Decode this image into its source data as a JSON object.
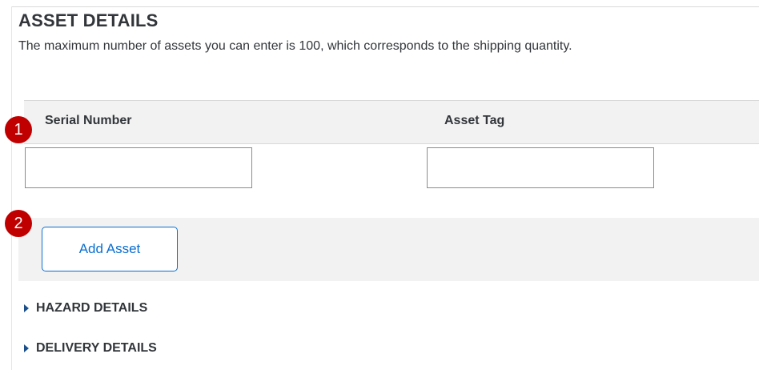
{
  "asset_details": {
    "title": "ASSET DETAILS",
    "description": "The maximum number of assets you can enter is 100, which corresponds to the shipping quantity.",
    "columns": [
      "Serial Number",
      "Asset Tag"
    ],
    "serial_number_value": "",
    "asset_tag_value": "",
    "add_button_label": "Add Asset"
  },
  "annotations": [
    "1",
    "2"
  ],
  "sections": [
    {
      "label": "HAZARD DETAILS",
      "icon": "triangle-right-icon"
    },
    {
      "label": "DELIVERY DETAILS",
      "icon": "triangle-right-icon"
    }
  ],
  "colors": {
    "accent": "#0a6ed1",
    "badge": "#c00000",
    "header_bg": "#f2f2f2",
    "caret": "#1a4f8b"
  }
}
